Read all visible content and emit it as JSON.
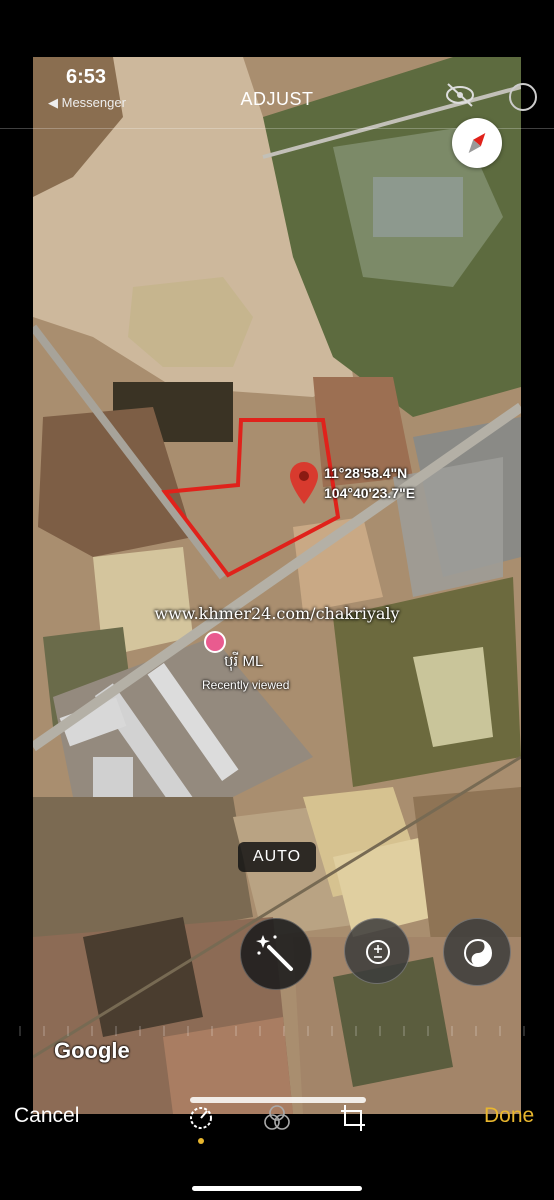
{
  "status": {
    "time": "6:53",
    "back_app": "◀ Messenger"
  },
  "header": {
    "title": "ADJUST"
  },
  "map": {
    "coordinates_lat": "11°28'58.4\"N",
    "coordinates_lon": "104°40'23.7\"E",
    "watermark": "www.khmer24.com/chakriyaly",
    "place_name": "បុរី ML",
    "place_sub": "Recently viewed",
    "google_logo": "Google",
    "boundary_color": "#e0221b",
    "pin_color": "#d83a2e"
  },
  "editor": {
    "auto_label": "AUTO",
    "tools": [
      "magic-wand-icon",
      "exposure-icon",
      "brilliance-icon"
    ],
    "modes": [
      "adjust-icon",
      "filters-icon",
      "crop-icon"
    ]
  },
  "footer": {
    "cancel_label": "Cancel",
    "done_label": "Done",
    "done_color": "#e8b62e"
  }
}
